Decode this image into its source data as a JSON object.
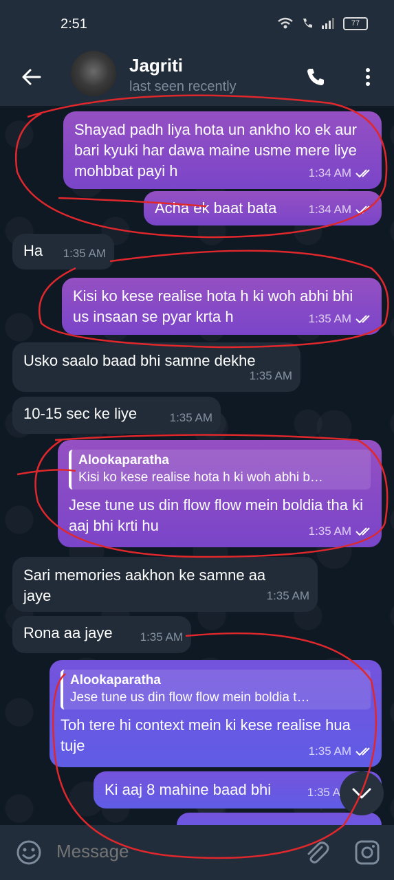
{
  "status_bar": {
    "time": "2:51",
    "battery": "77"
  },
  "header": {
    "contact_name": "Jagriti",
    "status": "last seen recently"
  },
  "messages": [
    {
      "text": "Shayad padh liya hota un ankho ko ek aur bari kyuki har dawa maine usme mere liye mohbbat payi h",
      "time": "1:34 AM"
    },
    {
      "text": "Acha ek baat bata",
      "time": "1:34 AM"
    },
    {
      "text": "Ha",
      "time": "1:35 AM"
    },
    {
      "text": "Kisi ko kese realise hota h ki woh abhi bhi us insaan se pyar krta h",
      "time": "1:35 AM"
    },
    {
      "text": "Usko saalo baad bhi samne dekhe",
      "time": "1:35 AM"
    },
    {
      "text": "10-15 sec ke liye",
      "time": "1:35 AM"
    },
    {
      "reply_name": "Alookaparatha",
      "reply_text": "Kisi ko kese realise hota h ki woh abhi b…",
      "text": "Jese tune us din flow flow mein boldia tha ki aaj bhi krti hu",
      "time": "1:35 AM"
    },
    {
      "text": "Sari memories aakhon ke samne aa jaye",
      "time": "1:35 AM"
    },
    {
      "text": "Rona aa jaye",
      "time": "1:35 AM"
    },
    {
      "reply_name": "Alookaparatha",
      "reply_text": "Jese tune us din flow flow mein boldia t…",
      "text": "Toh tere hi  context mein ki kese realise hua tuje",
      "time": "1:35 AM"
    },
    {
      "text": "Ki aaj 8 mahine baad bhi",
      "time": "1:35 A"
    }
  ],
  "composer": {
    "placeholder": "Message"
  },
  "icons": [
    "back-arrow-icon",
    "phone-icon",
    "more-vertical-icon",
    "emoji-icon",
    "paperclip-icon",
    "instagram-camera-icon",
    "chevron-down-icon",
    "double-check-icon",
    "wifi-icon",
    "signal-icon",
    "battery-icon"
  ],
  "colors": {
    "outgoing": "#8a4ec6",
    "outgoing_alt": "#6a58e2",
    "incoming": "#222c38",
    "header": "#212d3b",
    "annotation": "#e0282c"
  }
}
